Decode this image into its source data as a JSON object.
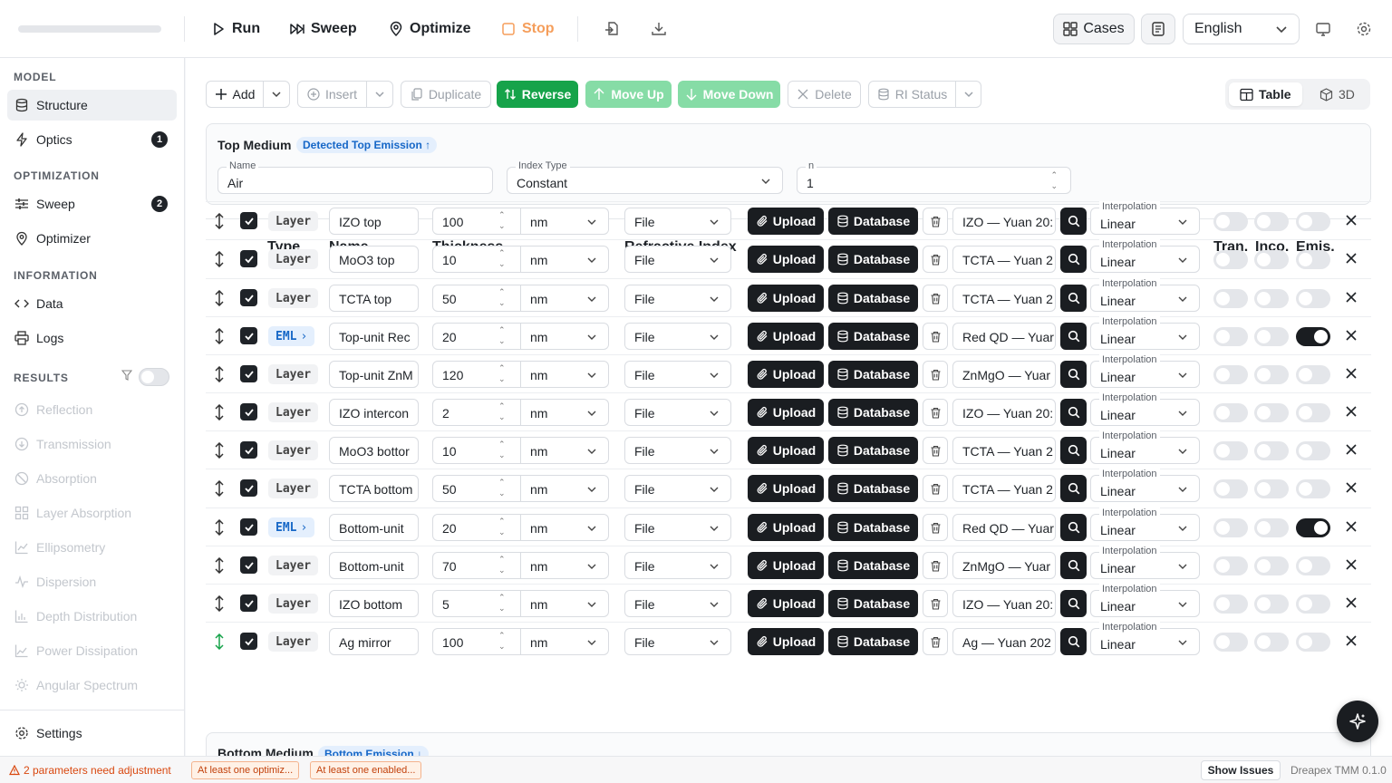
{
  "topbar": {
    "run": "Run",
    "sweep": "Sweep",
    "optimize": "Optimize",
    "stop": "Stop",
    "cases": "Cases",
    "language": "English"
  },
  "sidebar": {
    "model_header": "MODEL",
    "structure": "Structure",
    "optics": "Optics",
    "optics_badge": "1",
    "optimization_header": "OPTIMIZATION",
    "sweep": "Sweep",
    "sweep_badge": "2",
    "optimizer": "Optimizer",
    "information_header": "INFORMATION",
    "data": "Data",
    "logs": "Logs",
    "results_header": "RESULTS",
    "results": [
      "Reflection",
      "Transmission",
      "Absorption",
      "Layer Absorption",
      "Ellipsometry",
      "Dispersion",
      "Depth Distribution",
      "Power Dissipation",
      "Angular Spectrum"
    ],
    "settings": "Settings"
  },
  "toolbar": {
    "add": "Add",
    "insert": "Insert",
    "duplicate": "Duplicate",
    "reverse": "Reverse",
    "move_up": "Move Up",
    "move_down": "Move Down",
    "delete": "Delete",
    "ri_status": "RI Status",
    "view_table": "Table",
    "view_3d": "3D"
  },
  "top_medium": {
    "title": "Top Medium",
    "badge": "Detected Top Emission ↑",
    "name_label": "Name",
    "name_value": "Air",
    "index_type_label": "Index Type",
    "index_type_value": "Constant",
    "n_label": "n",
    "n_value": "1"
  },
  "table": {
    "headers": {
      "type": "Type",
      "name": "Name",
      "thickness": "Thickness",
      "refractive_index": "Refractive Index",
      "tran": "Tran.",
      "inco": "Inco.",
      "emis": "Emis."
    },
    "upload_label": "Upload",
    "database_label": "Database",
    "interp_label": "Interpolation",
    "interp_value": "Linear",
    "rows": [
      {
        "type": "Layer",
        "name": "IZO top",
        "thickness": "100",
        "unit": "nm",
        "source": "File",
        "material": "IZO — Yuan 20:",
        "tran": false,
        "inco": false,
        "emis": false
      },
      {
        "type": "Layer",
        "name": "MoO3 top",
        "thickness": "10",
        "unit": "nm",
        "source": "File",
        "material": "TCTA — Yuan 2",
        "tran": false,
        "inco": false,
        "emis": false
      },
      {
        "type": "Layer",
        "name": "TCTA top",
        "thickness": "50",
        "unit": "nm",
        "source": "File",
        "material": "TCTA — Yuan 2",
        "tran": false,
        "inco": false,
        "emis": false
      },
      {
        "type": "EML",
        "name": "Top-unit Rec",
        "thickness": "20",
        "unit": "nm",
        "source": "File",
        "material": "Red QD — Yuar",
        "tran": false,
        "inco": false,
        "emis": true
      },
      {
        "type": "Layer",
        "name": "Top-unit ZnM",
        "thickness": "120",
        "unit": "nm",
        "source": "File",
        "material": "ZnMgO — Yuar",
        "tran": false,
        "inco": false,
        "emis": false
      },
      {
        "type": "Layer",
        "name": "IZO intercon",
        "thickness": "2",
        "unit": "nm",
        "source": "File",
        "material": "IZO — Yuan 20:",
        "tran": false,
        "inco": false,
        "emis": false
      },
      {
        "type": "Layer",
        "name": "MoO3 bottor",
        "thickness": "10",
        "unit": "nm",
        "source": "File",
        "material": "TCTA — Yuan 2",
        "tran": false,
        "inco": false,
        "emis": false
      },
      {
        "type": "Layer",
        "name": "TCTA bottom",
        "thickness": "50",
        "unit": "nm",
        "source": "File",
        "material": "TCTA — Yuan 2",
        "tran": false,
        "inco": false,
        "emis": false
      },
      {
        "type": "EML",
        "name": "Bottom-unit",
        "thickness": "20",
        "unit": "nm",
        "source": "File",
        "material": "Red QD — Yuar",
        "tran": false,
        "inco": false,
        "emis": true
      },
      {
        "type": "Layer",
        "name": "Bottom-unit",
        "thickness": "70",
        "unit": "nm",
        "source": "File",
        "material": "ZnMgO — Yuar",
        "tran": false,
        "inco": false,
        "emis": false
      },
      {
        "type": "Layer",
        "name": "IZO bottom",
        "thickness": "5",
        "unit": "nm",
        "source": "File",
        "material": "IZO — Yuan 20:",
        "tran": false,
        "inco": false,
        "emis": false
      },
      {
        "type": "Layer",
        "name": "Ag mirror",
        "thickness": "100",
        "unit": "nm",
        "source": "File",
        "material": "Ag — Yuan 202",
        "tran": false,
        "inco": false,
        "emis": false
      }
    ]
  },
  "bottom_medium": {
    "title": "Bottom Medium",
    "badge": "Bottom Emission ↓"
  },
  "statusbar": {
    "warning": "2 parameters need adjustment",
    "chip1": "At least one optimiz...",
    "chip2": "At least one enabled...",
    "show_issues": "Show Issues",
    "version": "Dreapex TMM 0.1.0"
  }
}
